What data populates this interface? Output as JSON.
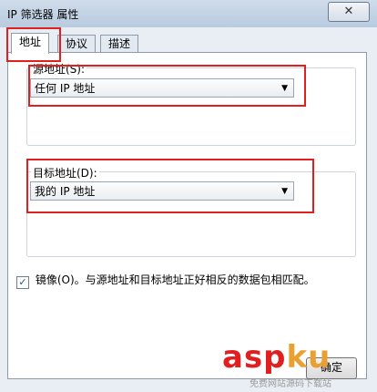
{
  "window": {
    "title": "IP 筛选器 属性",
    "close_glyph": "✕"
  },
  "tabs": [
    {
      "label": "地址",
      "active": true
    },
    {
      "label": "协议",
      "active": false
    },
    {
      "label": "描述",
      "active": false
    }
  ],
  "source": {
    "label": "源地址(S):",
    "value": "任何 IP 地址"
  },
  "destination": {
    "label": "目标地址(D):",
    "value": "我的 IP 地址"
  },
  "mirror": {
    "checked": true,
    "label": "镜像(O)。与源地址和目标地址正好相反的数据包相匹配。"
  },
  "buttons": {
    "ok": "确定"
  },
  "watermark": {
    "main_a": "asp",
    "main_b": "ku",
    "sub": "免费网站源码下载站"
  },
  "colors": {
    "highlight": "#e0201e"
  }
}
